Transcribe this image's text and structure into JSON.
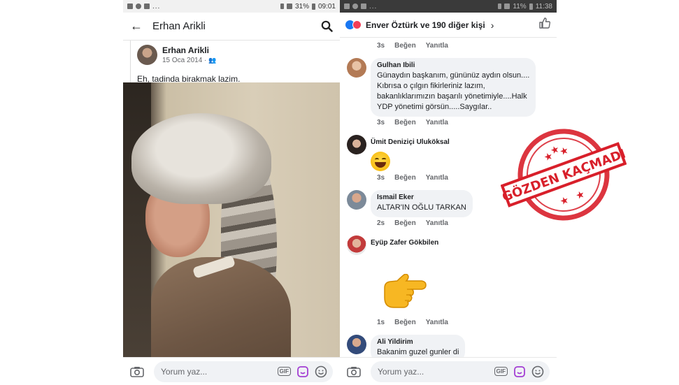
{
  "left": {
    "status": {
      "battery": "31%",
      "time": "09:01"
    },
    "header": {
      "back_icon": "arrow-left-icon",
      "title": "Erhan Arikli",
      "search_icon": "search-icon"
    },
    "post": {
      "author": "Erhan Arikli",
      "date": "15 Oca 2014 ·",
      "audience_icon": "friends-icon",
      "text": "Eh, tadinda birakmak lazim."
    },
    "comment_bar": {
      "placeholder": "Yorum yaz...",
      "gif_label": "GIF"
    }
  },
  "right": {
    "status": {
      "battery": "11%",
      "time": "11:38"
    },
    "header": {
      "reactions_label": "Enver Öztürk ve 190 diğer kişi",
      "like_icon": "thumbs-up-icon"
    },
    "top_actions": {
      "time": "3s",
      "like": "Beğen",
      "reply": "Yanıtla"
    },
    "comments": [
      {
        "name": "Gulhan Ibili",
        "lines": [
          "Günaydın başkanım, gününüz aydın olsun....",
          "Kıbrısa o çılgın fikirleriniz lazım,",
          "bakanlıklarımızın başarılı yönetimiyle....Halk",
          "YDP  yönetimi görsün.....Saygılar.."
        ],
        "time": "3s",
        "like": "Beğen",
        "reply": "Yanıtla"
      },
      {
        "name": "Ümit Deniziçi Uluköksal",
        "time": "3s",
        "like": "Beğen",
        "reply": "Yanıtla"
      },
      {
        "name": "Ismail Eker",
        "text": "ALTAR'IN OĞLU TARKAN",
        "time": "2s",
        "like": "Beğen",
        "reply": "Yanıtla"
      },
      {
        "name": "Eyüp Zafer Gökbilen",
        "time": "1s",
        "like": "Beğen",
        "reply": "Yanıtla"
      },
      {
        "name": "Ali Yildirim",
        "text": "Bakanim guzel gunler di"
      }
    ],
    "comment_bar": {
      "placeholder": "Yorum yaz...",
      "gif_label": "GIF"
    }
  },
  "stamp": {
    "text": "GÖZDEN KAÇMADI",
    "color": "#d81f2a"
  },
  "colors": {
    "facebook_blue": "#1877f2",
    "love_red": "#f33e58",
    "bubble_gray": "#f0f2f5"
  }
}
